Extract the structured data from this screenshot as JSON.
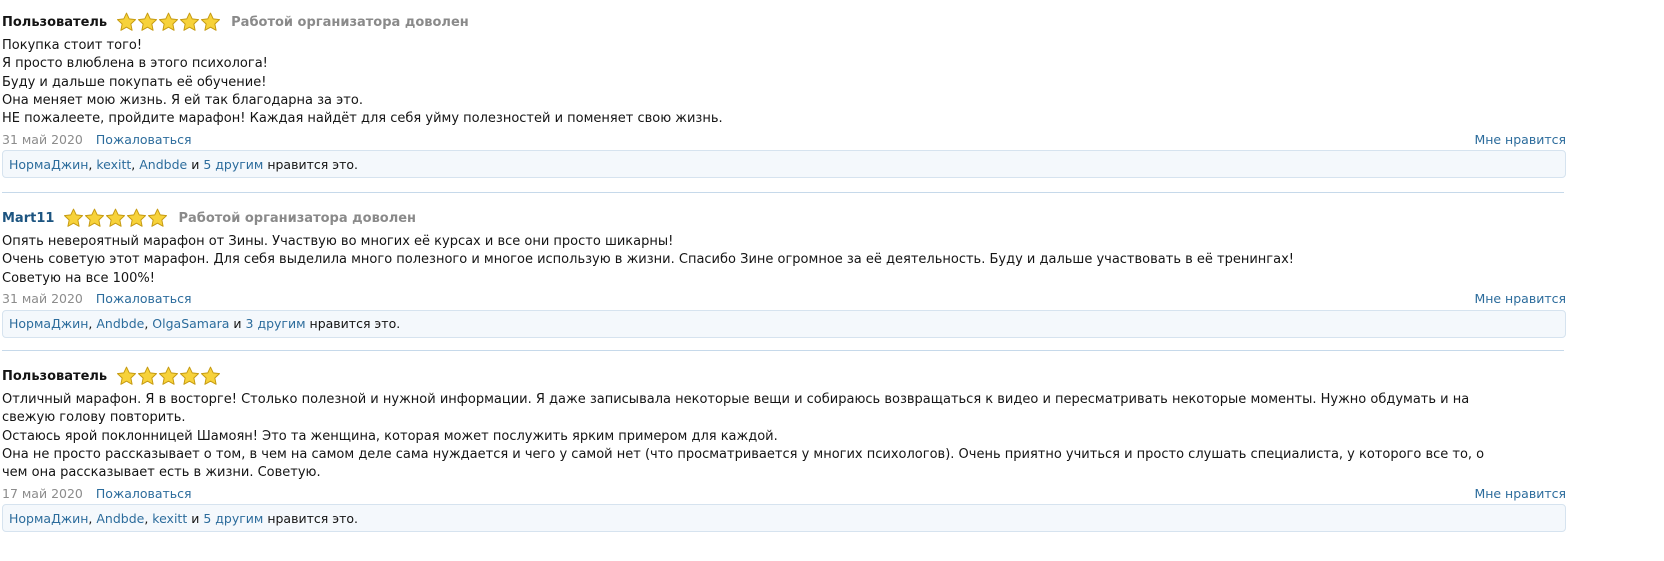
{
  "icons": {
    "star": "star-icon"
  },
  "colors": {
    "star_fill": "#f7d23a",
    "star_stroke": "#c59a12",
    "link": "#2c6c9c",
    "box_bg": "#f4f8fc",
    "box_border": "#d6e3ef"
  },
  "reviews": [
    {
      "author": "Пользователь",
      "rating": 5,
      "verdict": "Работой организатора доволен",
      "text": [
        "Покупка стоит того!",
        "Я просто влюблена в этого психолога!",
        "Буду и дальше покупать её обучение!",
        "Она меняет мою жизнь. Я ей так благодарна за это.",
        "НЕ пожалеете, пройдите марафон! Каждая найдёт для себя уйму полезностей и поменяет свою жизнь."
      ],
      "date": "31 май 2020",
      "report": "Пожаловаться",
      "like": "Мне нравится",
      "likes": {
        "users": [
          "НормаДжин",
          "kexitt",
          "Andbde"
        ],
        "conj": "и",
        "others": "5 другим",
        "suffix": "нравится это."
      }
    },
    {
      "author": "Mart11",
      "rating": 5,
      "verdict": "Работой организатора доволен",
      "text": [
        "Опять невероятный марафон от Зины. Участвую во многих её курсах и все они просто шикарны!",
        "Очень советую этот марафон. Для себя выделила много полезного и многое использую в жизни. Спасибо Зине огромное за её деятельность. Буду и дальше участвовать в её тренингах!",
        "Советую на все 100%!"
      ],
      "date": "31 май 2020",
      "report": "Пожаловаться",
      "like": "Мне нравится",
      "likes": {
        "users": [
          "НормаДжин",
          "Andbde",
          "OlgaSamara"
        ],
        "conj": "и",
        "others": "3 другим",
        "suffix": "нравится это."
      }
    },
    {
      "author": "Пользователь",
      "rating": 5,
      "verdict": "",
      "text": [
        "Отличный марафон. Я в восторге! Столько полезной и нужной информации. Я даже записывала некоторые вещи и собираюсь возвращаться к видео и пересматривать некоторые моменты. Нужно обдумать и на свежую голову повторить.",
        "Остаюсь ярой поклонницей Шамоян! Это та женщина, которая может послужить ярким примером для каждой.",
        "Она не просто рассказывает о том, в чем на самом деле сама нуждается и чего у самой нет (что просматривается у многих психологов). Очень приятно учиться и просто слушать специалиста, у которого все то, о чем она рассказывает есть в жизни. Советую."
      ],
      "date": "17 май 2020",
      "report": "Пожаловаться",
      "like": "Мне нравится",
      "likes": {
        "users": [
          "НормаДжин",
          "Andbde",
          "kexitt"
        ],
        "conj": "и",
        "others": "5 другим",
        "suffix": "нравится это."
      }
    }
  ]
}
